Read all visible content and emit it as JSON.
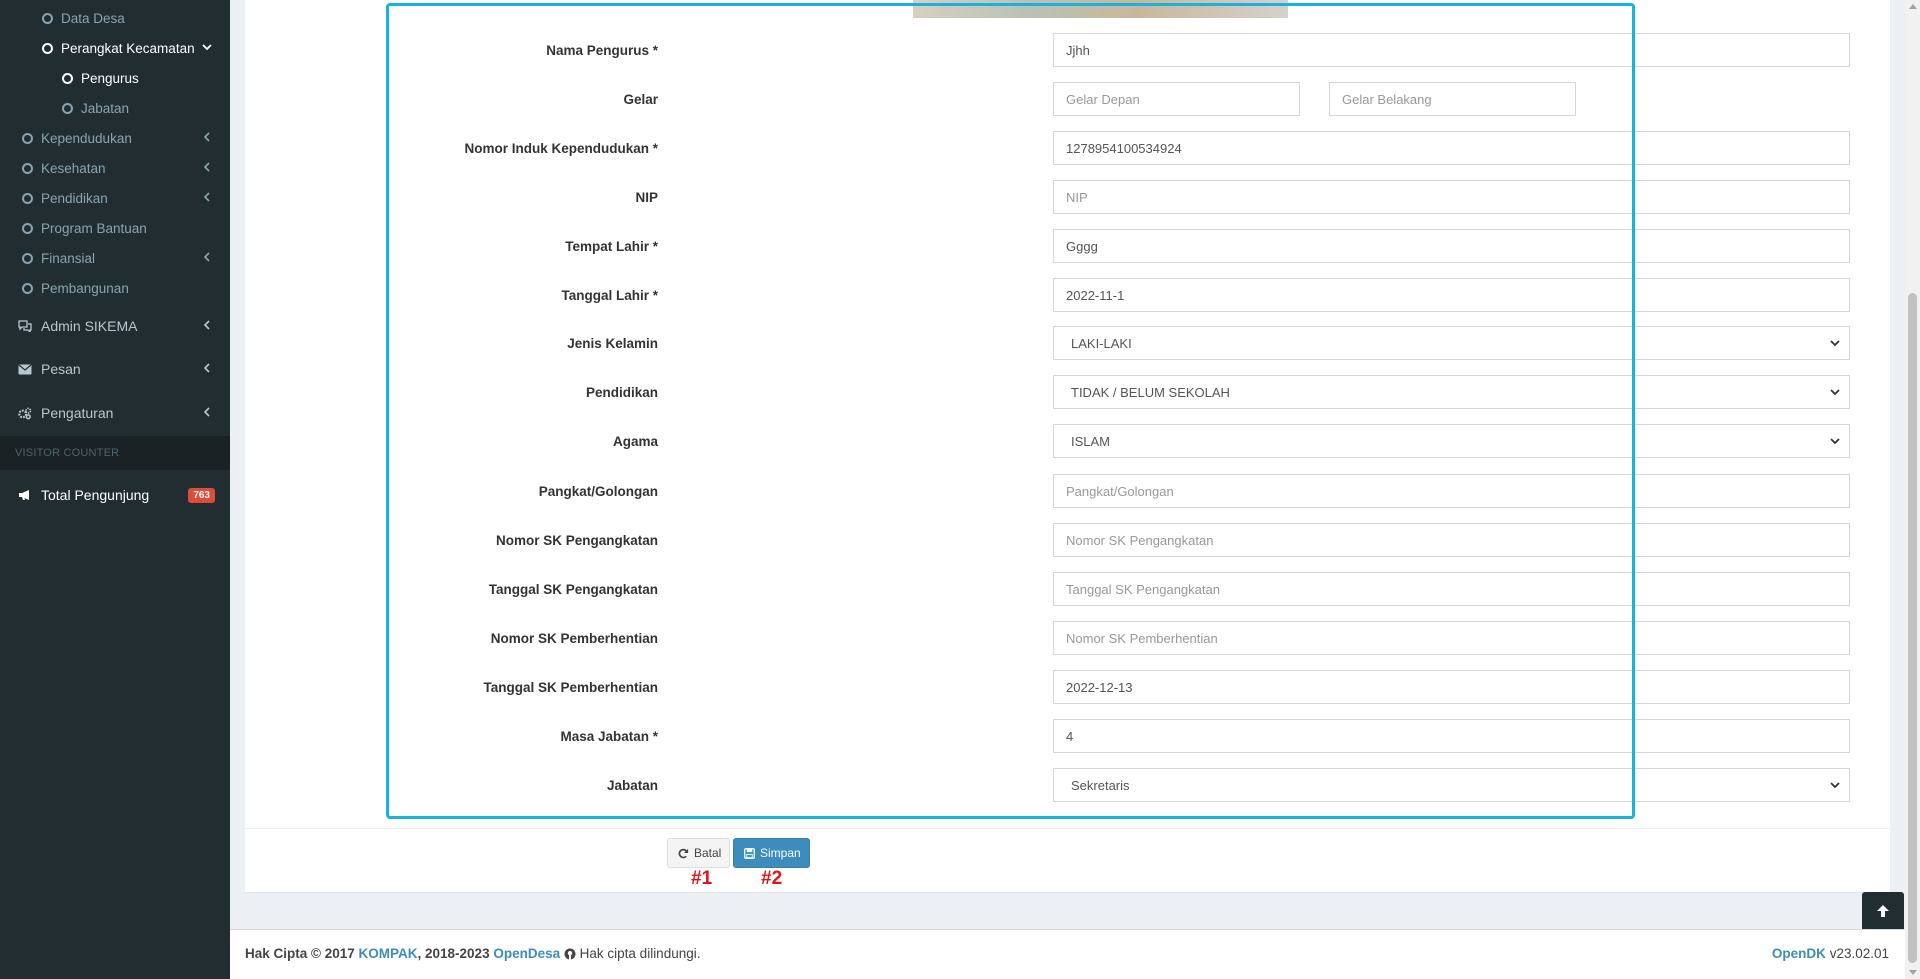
{
  "sidebar": {
    "items": [
      {
        "label": "Data Desa",
        "level": 2
      },
      {
        "label": "Perangkat Kecamatan",
        "level": 2
      },
      {
        "label": "Pengurus",
        "level": 3
      },
      {
        "label": "Jabatan",
        "level": 3
      },
      {
        "label": "Kependudukan"
      },
      {
        "label": "Kesehatan"
      },
      {
        "label": "Pendidikan"
      },
      {
        "label": "Program Bantuan"
      },
      {
        "label": "Finansial"
      },
      {
        "label": "Pembangunan"
      }
    ],
    "admin_sikema": "Admin SIKEMA",
    "pesan": "Pesan",
    "pengaturan": "Pengaturan",
    "visitor_header": "VISITOR COUNTER",
    "total_pengunjung": "Total Pengunjung",
    "total_pengunjung_count": "763"
  },
  "form": {
    "nama_pengurus": {
      "label": "Nama Pengurus *",
      "value": "Jjhh"
    },
    "gelar": {
      "label": "Gelar",
      "depan_placeholder": "Gelar Depan",
      "belakang_placeholder": "Gelar Belakang"
    },
    "nik": {
      "label": "Nomor Induk Kependudukan *",
      "value": "1278954100534924"
    },
    "nip": {
      "label": "NIP",
      "placeholder": "NIP"
    },
    "tempat_lahir": {
      "label": "Tempat Lahir *",
      "value": "Gggg"
    },
    "tanggal_lahir": {
      "label": "Tanggal Lahir *",
      "value": "2022-11-1"
    },
    "jenis_kelamin": {
      "label": "Jenis Kelamin",
      "value": "LAKI-LAKI"
    },
    "pendidikan": {
      "label": "Pendidikan",
      "value": "TIDAK / BELUM SEKOLAH"
    },
    "agama": {
      "label": "Agama",
      "value": "ISLAM"
    },
    "pangkat": {
      "label": "Pangkat/Golongan",
      "placeholder": "Pangkat/Golongan"
    },
    "no_sk_angkat": {
      "label": "Nomor SK Pengangkatan",
      "placeholder": "Nomor SK Pengangkatan"
    },
    "tgl_sk_angkat": {
      "label": "Tanggal SK Pengangkatan",
      "placeholder": "Tanggal SK Pengangkatan"
    },
    "no_sk_henti": {
      "label": "Nomor SK Pemberhentian",
      "placeholder": "Nomor SK Pemberhentian"
    },
    "tgl_sk_henti": {
      "label": "Tanggal SK Pemberhentian",
      "value": "2022-12-13"
    },
    "masa_jabatan": {
      "label": "Masa Jabatan *",
      "value": "4"
    },
    "jabatan": {
      "label": "Jabatan",
      "value": "Sekretaris"
    }
  },
  "buttons": {
    "batal": "Batal",
    "simpan": "Simpan"
  },
  "markers": {
    "one": "#1",
    "two": "#2"
  },
  "footer": {
    "copyright_prefix": "Hak Cipta © 2017",
    "kompak": "KOMPAK",
    "years": ", 2018-2023",
    "opendesa": "OpenDesa",
    "rights": "Hak cipta dilindungi.",
    "opendk": "OpenDK",
    "version": "v23.02.01"
  },
  "colors": {
    "sidebar_bg": "#222d32",
    "highlight": "#1ab1e0",
    "primary": "#3c8dbc",
    "badge": "#dd4b39",
    "marker": "#e01515"
  }
}
